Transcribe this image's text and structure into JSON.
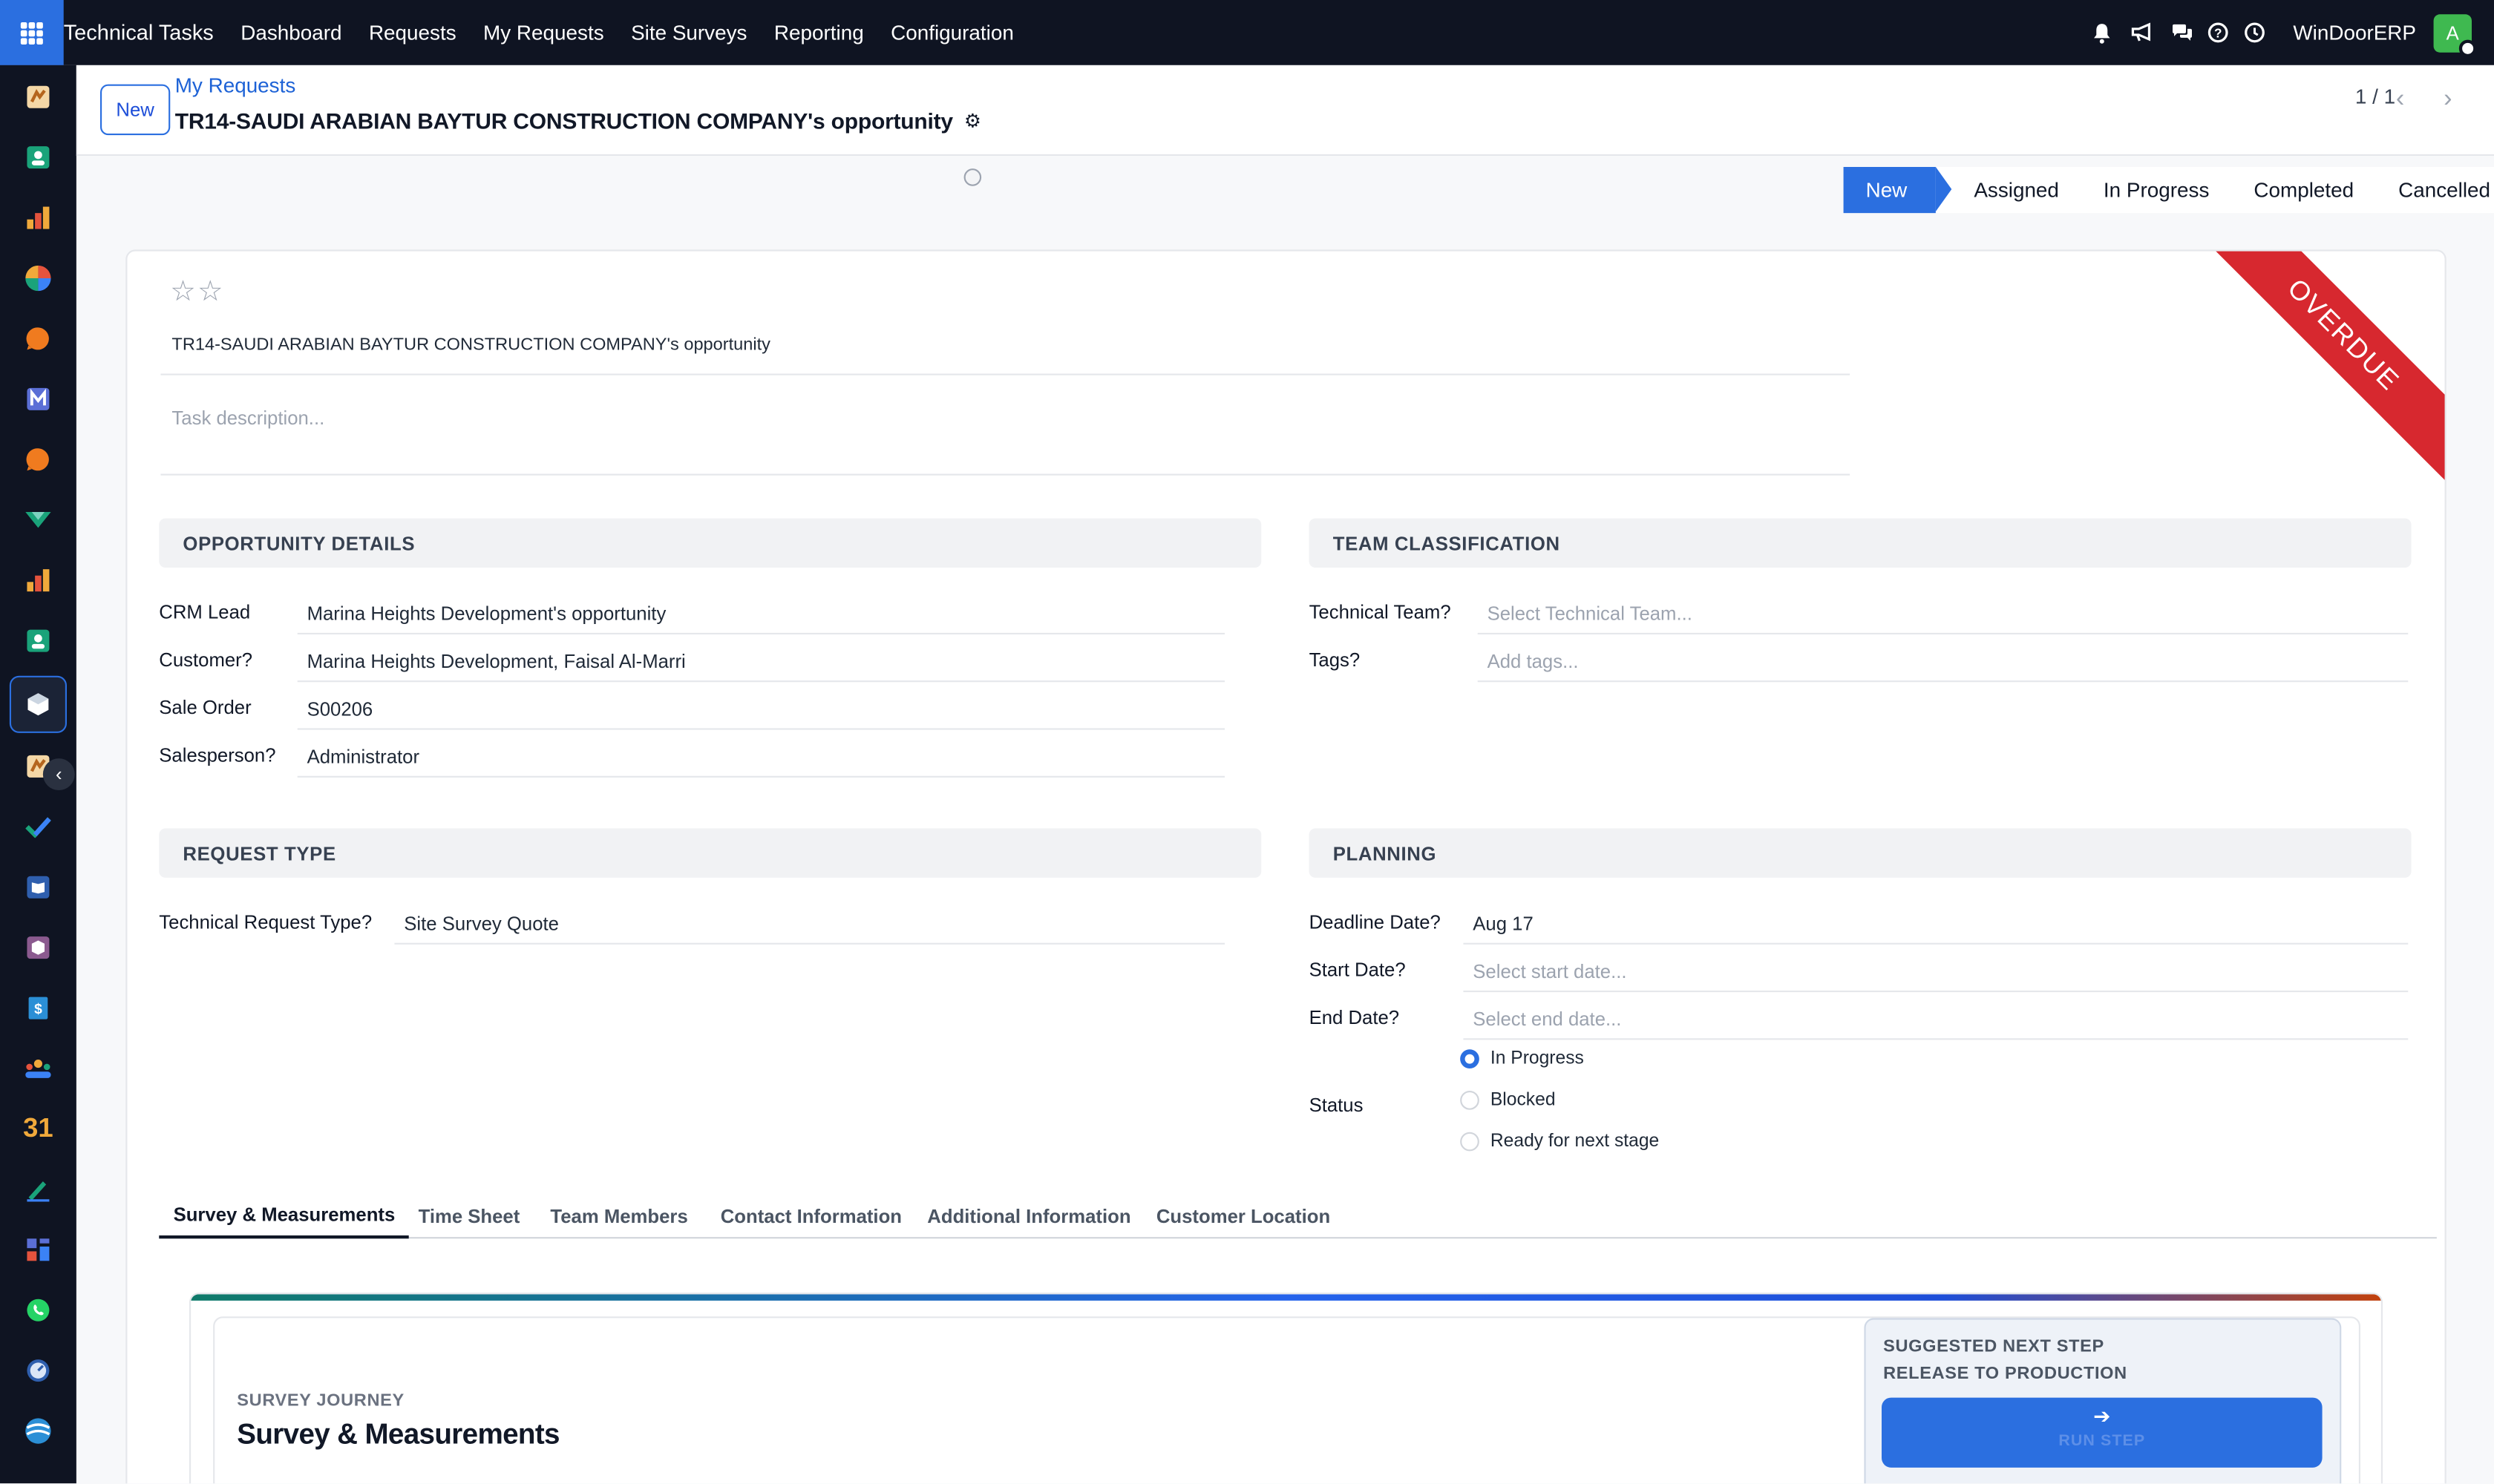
{
  "navbar": {
    "app_name": "Technical Tasks",
    "menu": [
      "Dashboard",
      "Requests",
      "My Requests",
      "Site Surveys",
      "Reporting",
      "Configuration"
    ],
    "company": "WinDoorERP",
    "avatar_letter": "A"
  },
  "sidebar": {
    "icons": [
      "discuss-icon",
      "contacts-icon",
      "dashboards-icon",
      "crm-icon",
      "live-chat-icon",
      "email-marketing-icon",
      "chat-icon",
      "vendor-icon",
      "sales-icon",
      "employees-icon",
      "technical-tasks-icon",
      "documents-icon",
      "tasks-icon",
      "knowledge-icon",
      "inventory-icon",
      "invoicing-icon",
      "team-icon",
      "calendar-icon",
      "sign-icon",
      "apps-icon",
      "whatsapp-icon",
      "timer-icon",
      "wave-icon"
    ],
    "calendar_number": "31",
    "collapse_glyph": "‹"
  },
  "control": {
    "new_label": "New",
    "breadcrumb": "My Requests",
    "title": "TR14-SAUDI ARABIAN BAYTUR CONSTRUCTION COMPANY's opportunity",
    "pager": "1 / 1"
  },
  "stages": {
    "items": [
      "New",
      "Assigned",
      "In Progress",
      "Completed",
      "Cancelled"
    ],
    "current": "New"
  },
  "form": {
    "ribbon": "OVERDUE",
    "task_name": "TR14-SAUDI ARABIAN BAYTUR CONSTRUCTION COMPANY's opportunity",
    "description_placeholder": "Task description...",
    "opportunity": {
      "heading": "OPPORTUNITY DETAILS",
      "crm_lead_label": "CRM Lead",
      "crm_lead_value": "Marina Heights Development's opportunity",
      "customer_label": "Customer?",
      "customer_value": "Marina Heights Development, Faisal Al-Marri",
      "sale_order_label": "Sale Order",
      "sale_order_value": "S00206",
      "salesperson_label": "Salesperson?",
      "salesperson_value": "Administrator"
    },
    "team": {
      "heading": "TEAM CLASSIFICATION",
      "technical_team_label": "Technical Team?",
      "technical_team_placeholder": "Select Technical Team...",
      "tags_label": "Tags?",
      "tags_placeholder": "Add tags..."
    },
    "request_type": {
      "heading": "REQUEST TYPE",
      "label": "Technical Request Type?",
      "value": "Site Survey Quote"
    },
    "planning": {
      "heading": "PLANNING",
      "deadline_label": "Deadline Date?",
      "deadline_value": "Aug 17",
      "start_label": "Start Date?",
      "start_placeholder": "Select start date...",
      "end_label": "End Date?",
      "end_placeholder": "Select end date...",
      "status_label": "Status",
      "status_options": [
        "In Progress",
        "Blocked",
        "Ready for next stage"
      ],
      "status_selected": "In Progress"
    }
  },
  "tabs": {
    "items": [
      "Survey & Measurements",
      "Time Sheet",
      "Team Members",
      "Contact Information",
      "Additional Information",
      "Customer Location"
    ],
    "active": "Survey & Measurements"
  },
  "journey": {
    "kicker": "SURVEY JOURNEY",
    "title": "Survey & Measurements",
    "next_kicker": "SUGGESTED NEXT STEP",
    "next_step": "RELEASE TO PRODUCTION",
    "run_label": "RUN STEP"
  },
  "colors": {
    "accent": "#2b6fe0",
    "navbar": "#0f1422",
    "ribbon": "#d7282f"
  }
}
